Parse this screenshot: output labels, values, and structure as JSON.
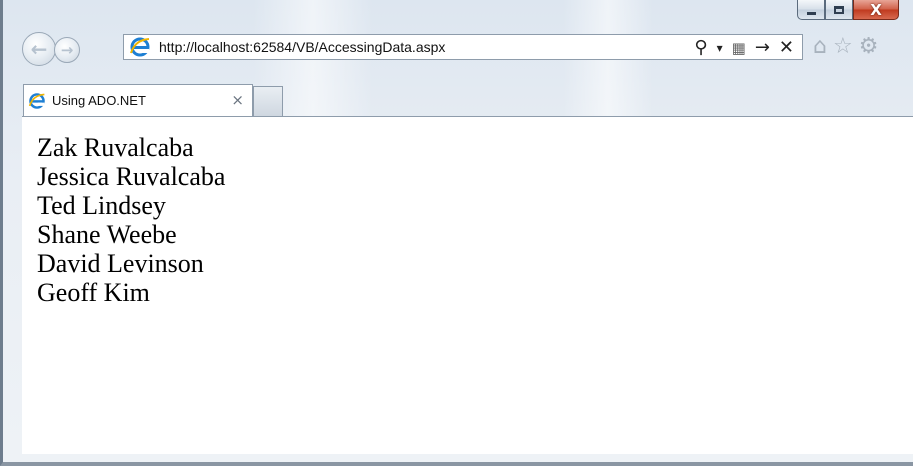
{
  "window": {
    "caption_buttons": [
      "minimize-icon",
      "maximize-icon",
      "close-icon"
    ],
    "close_glyph": "X",
    "accent_close": "#c9462b"
  },
  "navigation": {
    "back_icon": "back-arrow-icon",
    "forward_icon": "forward-arrow-icon",
    "address_url": "http://localhost:62584/VB/AccessingData.aspx",
    "address_tools": {
      "search": "⚲",
      "dropdown": "▾",
      "compat": "▦",
      "go": "→",
      "stop": "✕"
    },
    "right_icons": {
      "home": "⌂",
      "favorites": "☆",
      "settings": "⚙"
    }
  },
  "tabs": [
    {
      "label": "Using ADO.NET",
      "close": "×",
      "icon": "ie-logo-icon"
    }
  ],
  "content": {
    "names": [
      "Zak Ruvalcaba",
      "Jessica Ruvalcaba",
      "Ted Lindsey",
      "Shane Weebe",
      "David Levinson",
      "Geoff Kim"
    ]
  }
}
